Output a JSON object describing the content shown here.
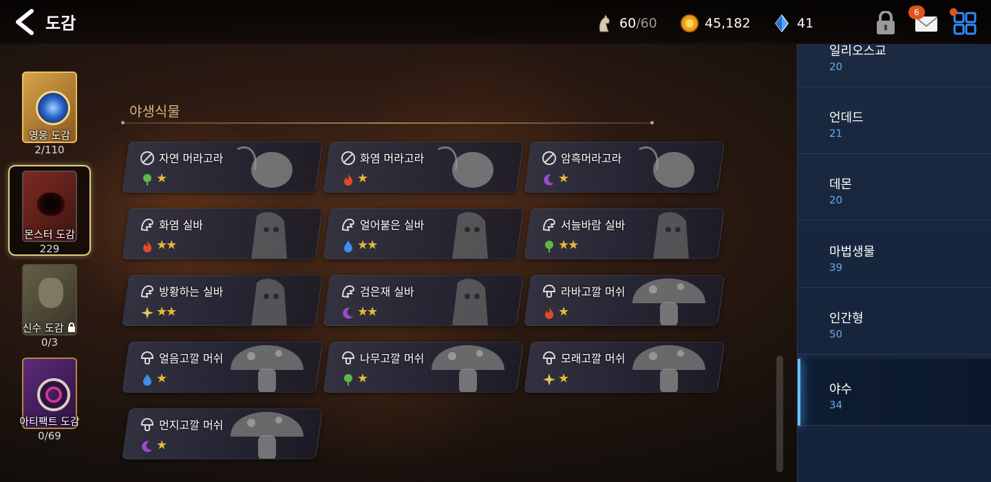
{
  "header": {
    "title": "도감",
    "stamina": {
      "current": "60",
      "max": "/60"
    },
    "gold": "45,182",
    "gems": "41",
    "mail_badge": "6"
  },
  "books": [
    {
      "label": "영웅 도감",
      "count": "2/110",
      "selected": false,
      "locked": false
    },
    {
      "label": "몬스터 도감",
      "count": "229",
      "selected": true,
      "locked": false
    },
    {
      "label": "신수 도감",
      "count": "0/3",
      "selected": false,
      "locked": true
    },
    {
      "label": "아티팩트 도감",
      "count": "0/69",
      "selected": false,
      "locked": false
    }
  ],
  "section": {
    "title": "야생식물"
  },
  "monsters": [
    {
      "name": "자연 머라고라",
      "type_icon": "mandragora-icon",
      "element": "nature",
      "stars": 1
    },
    {
      "name": "화염 머라고라",
      "type_icon": "mandragora-icon",
      "element": "fire",
      "stars": 1
    },
    {
      "name": "암흑머라고라",
      "type_icon": "mandragora-icon",
      "element": "dark",
      "stars": 1
    },
    {
      "name": "화염 실바",
      "type_icon": "silva-icon",
      "element": "fire",
      "stars": 2
    },
    {
      "name": "얼어붙은 실바",
      "type_icon": "silva-icon",
      "element": "water",
      "stars": 2
    },
    {
      "name": "서늘바람 실바",
      "type_icon": "silva-icon",
      "element": "nature",
      "stars": 2
    },
    {
      "name": "방황하는 실바",
      "type_icon": "silva-icon",
      "element": "light",
      "stars": 2
    },
    {
      "name": "검은재 실바",
      "type_icon": "silva-icon",
      "element": "dark",
      "stars": 2
    },
    {
      "name": "라바고깔 머쉬",
      "type_icon": "mush-icon",
      "element": "fire",
      "stars": 1
    },
    {
      "name": "얼음고깔 머쉬",
      "type_icon": "mush-icon",
      "element": "water",
      "stars": 1
    },
    {
      "name": "나무고깔 머쉬",
      "type_icon": "mush-icon",
      "element": "nature",
      "stars": 1
    },
    {
      "name": "모래고깔 머쉬",
      "type_icon": "mush-icon",
      "element": "light",
      "stars": 1
    },
    {
      "name": "먼지고깔 머쉬",
      "type_icon": "mush-icon",
      "element": "dark",
      "stars": 1
    }
  ],
  "categories": [
    {
      "name": "일리오스교",
      "count": "20",
      "active": false
    },
    {
      "name": "언데드",
      "count": "21",
      "active": false
    },
    {
      "name": "데몬",
      "count": "20",
      "active": false
    },
    {
      "name": "마법생물",
      "count": "39",
      "active": false
    },
    {
      "name": "인간형",
      "count": "50",
      "active": false
    },
    {
      "name": "야수",
      "count": "34",
      "active": true
    }
  ],
  "colors": {
    "accent_gold": "#d8b57a",
    "star": "#e7b93a",
    "category_count": "#67a8e8",
    "badge": "#e0531f",
    "fire": "#e2472a",
    "water": "#3d8fe8",
    "nature": "#5cb84a",
    "dark": "#9a4ad0",
    "light": "#e8c860"
  }
}
